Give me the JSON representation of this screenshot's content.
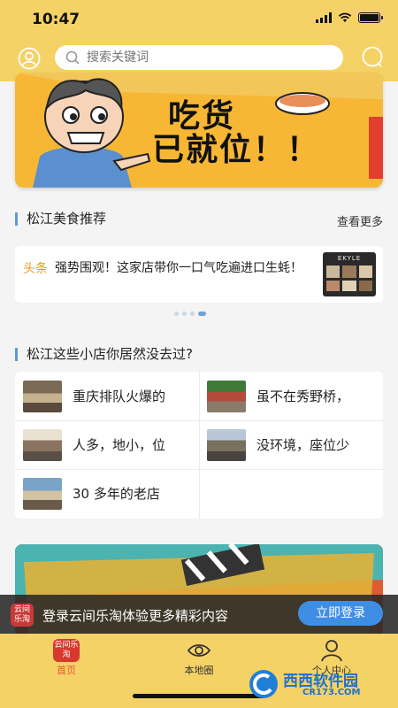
{
  "status": {
    "time": "10:47"
  },
  "search": {
    "placeholder": "搜索关键词"
  },
  "banner": {
    "line1": "吃货",
    "line2": "已就位！！"
  },
  "food_section": {
    "title": "松江美食推荐",
    "more": "查看更多"
  },
  "news": {
    "tag": "头条",
    "text": "强势围观！这家店带你一口气吃遍进口生蚝！",
    "thumb_title": "EKYLE"
  },
  "carousel": {
    "count": 4,
    "active": 3
  },
  "stores_section": {
    "title": "松江这些小店你居然没去过?",
    "items": [
      {
        "name": "重庆排队火爆的"
      },
      {
        "name": "虽不在秀野桥，"
      },
      {
        "name": "人多，地小，位"
      },
      {
        "name": "没环境，座位少"
      },
      {
        "name": "30 多年的老店"
      }
    ]
  },
  "login_bar": {
    "logo": "云间乐淘",
    "text": "登录云间乐淘体验更多精彩内容",
    "button": "立即登录"
  },
  "tabs": [
    {
      "label": "首页",
      "icon_text": "云间乐淘"
    },
    {
      "label": "本地圈"
    },
    {
      "label": "个人中心"
    }
  ],
  "watermark": {
    "brand": "西西软件园",
    "url": "CR173.COM"
  },
  "colors": {
    "header": "#f5d265",
    "accent": "#3e8ee6",
    "tag": "#f09a1a",
    "active_tab": "#e25b2e"
  }
}
